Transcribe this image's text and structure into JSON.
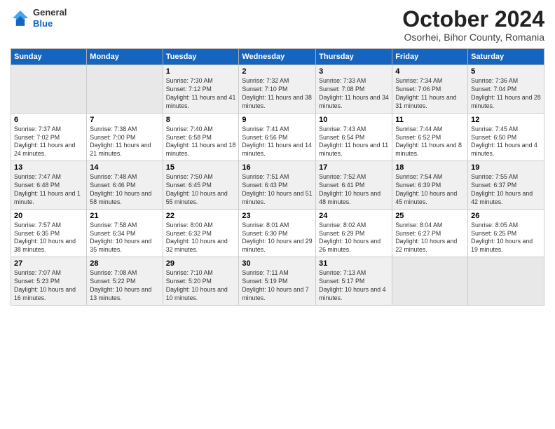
{
  "header": {
    "logo": {
      "general": "General",
      "blue": "Blue"
    },
    "title": "October 2024",
    "location": "Osorhei, Bihor County, Romania"
  },
  "weekdays": [
    "Sunday",
    "Monday",
    "Tuesday",
    "Wednesday",
    "Thursday",
    "Friday",
    "Saturday"
  ],
  "weeks": [
    [
      {
        "day": "",
        "info": ""
      },
      {
        "day": "",
        "info": ""
      },
      {
        "day": "1",
        "info": "Sunrise: 7:30 AM\nSunset: 7:12 PM\nDaylight: 11 hours and 41 minutes."
      },
      {
        "day": "2",
        "info": "Sunrise: 7:32 AM\nSunset: 7:10 PM\nDaylight: 11 hours and 38 minutes."
      },
      {
        "day": "3",
        "info": "Sunrise: 7:33 AM\nSunset: 7:08 PM\nDaylight: 11 hours and 34 minutes."
      },
      {
        "day": "4",
        "info": "Sunrise: 7:34 AM\nSunset: 7:06 PM\nDaylight: 11 hours and 31 minutes."
      },
      {
        "day": "5",
        "info": "Sunrise: 7:36 AM\nSunset: 7:04 PM\nDaylight: 11 hours and 28 minutes."
      }
    ],
    [
      {
        "day": "6",
        "info": "Sunrise: 7:37 AM\nSunset: 7:02 PM\nDaylight: 11 hours and 24 minutes."
      },
      {
        "day": "7",
        "info": "Sunrise: 7:38 AM\nSunset: 7:00 PM\nDaylight: 11 hours and 21 minutes."
      },
      {
        "day": "8",
        "info": "Sunrise: 7:40 AM\nSunset: 6:58 PM\nDaylight: 11 hours and 18 minutes."
      },
      {
        "day": "9",
        "info": "Sunrise: 7:41 AM\nSunset: 6:56 PM\nDaylight: 11 hours and 14 minutes."
      },
      {
        "day": "10",
        "info": "Sunrise: 7:43 AM\nSunset: 6:54 PM\nDaylight: 11 hours and 11 minutes."
      },
      {
        "day": "11",
        "info": "Sunrise: 7:44 AM\nSunset: 6:52 PM\nDaylight: 11 hours and 8 minutes."
      },
      {
        "day": "12",
        "info": "Sunrise: 7:45 AM\nSunset: 6:50 PM\nDaylight: 11 hours and 4 minutes."
      }
    ],
    [
      {
        "day": "13",
        "info": "Sunrise: 7:47 AM\nSunset: 6:48 PM\nDaylight: 11 hours and 1 minute."
      },
      {
        "day": "14",
        "info": "Sunrise: 7:48 AM\nSunset: 6:46 PM\nDaylight: 10 hours and 58 minutes."
      },
      {
        "day": "15",
        "info": "Sunrise: 7:50 AM\nSunset: 6:45 PM\nDaylight: 10 hours and 55 minutes."
      },
      {
        "day": "16",
        "info": "Sunrise: 7:51 AM\nSunset: 6:43 PM\nDaylight: 10 hours and 51 minutes."
      },
      {
        "day": "17",
        "info": "Sunrise: 7:52 AM\nSunset: 6:41 PM\nDaylight: 10 hours and 48 minutes."
      },
      {
        "day": "18",
        "info": "Sunrise: 7:54 AM\nSunset: 6:39 PM\nDaylight: 10 hours and 45 minutes."
      },
      {
        "day": "19",
        "info": "Sunrise: 7:55 AM\nSunset: 6:37 PM\nDaylight: 10 hours and 42 minutes."
      }
    ],
    [
      {
        "day": "20",
        "info": "Sunrise: 7:57 AM\nSunset: 6:35 PM\nDaylight: 10 hours and 38 minutes."
      },
      {
        "day": "21",
        "info": "Sunrise: 7:58 AM\nSunset: 6:34 PM\nDaylight: 10 hours and 35 minutes."
      },
      {
        "day": "22",
        "info": "Sunrise: 8:00 AM\nSunset: 6:32 PM\nDaylight: 10 hours and 32 minutes."
      },
      {
        "day": "23",
        "info": "Sunrise: 8:01 AM\nSunset: 6:30 PM\nDaylight: 10 hours and 29 minutes."
      },
      {
        "day": "24",
        "info": "Sunrise: 8:02 AM\nSunset: 6:29 PM\nDaylight: 10 hours and 26 minutes."
      },
      {
        "day": "25",
        "info": "Sunrise: 8:04 AM\nSunset: 6:27 PM\nDaylight: 10 hours and 22 minutes."
      },
      {
        "day": "26",
        "info": "Sunrise: 8:05 AM\nSunset: 6:25 PM\nDaylight: 10 hours and 19 minutes."
      }
    ],
    [
      {
        "day": "27",
        "info": "Sunrise: 7:07 AM\nSunset: 5:23 PM\nDaylight: 10 hours and 16 minutes."
      },
      {
        "day": "28",
        "info": "Sunrise: 7:08 AM\nSunset: 5:22 PM\nDaylight: 10 hours and 13 minutes."
      },
      {
        "day": "29",
        "info": "Sunrise: 7:10 AM\nSunset: 5:20 PM\nDaylight: 10 hours and 10 minutes."
      },
      {
        "day": "30",
        "info": "Sunrise: 7:11 AM\nSunset: 5:19 PM\nDaylight: 10 hours and 7 minutes."
      },
      {
        "day": "31",
        "info": "Sunrise: 7:13 AM\nSunset: 5:17 PM\nDaylight: 10 hours and 4 minutes."
      },
      {
        "day": "",
        "info": ""
      },
      {
        "day": "",
        "info": ""
      }
    ]
  ]
}
